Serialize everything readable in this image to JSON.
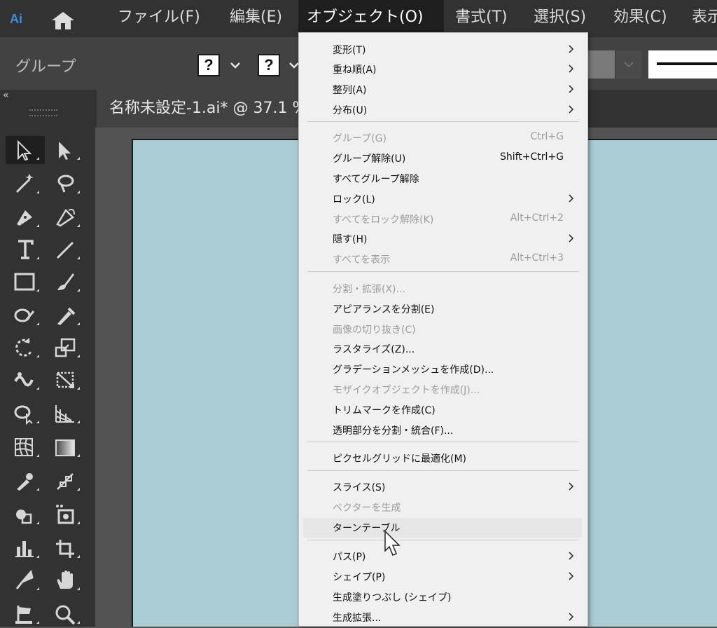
{
  "app": {
    "logo": "Ai"
  },
  "menubar": {
    "items": [
      {
        "label": "ファイル(F)"
      },
      {
        "label": "編集(E)"
      },
      {
        "label": "オブジェクト(O)"
      },
      {
        "label": "書式(T)"
      },
      {
        "label": "選択(S)"
      },
      {
        "label": "効果(C)"
      },
      {
        "label": "表示"
      }
    ],
    "active_index": 2
  },
  "control_bar": {
    "selection_label": "グループ",
    "unknown_fill": "?",
    "unknown_stroke": "?"
  },
  "document": {
    "tab_title": "名称未設定-1.ai* @ 37.1 %"
  },
  "object_menu": {
    "items": [
      {
        "label": "変形(T)",
        "shortcut": "",
        "submenu": true,
        "enabled": true
      },
      {
        "label": "重ね順(A)",
        "shortcut": "",
        "submenu": true,
        "enabled": true
      },
      {
        "label": "整列(A)",
        "shortcut": "",
        "submenu": true,
        "enabled": true
      },
      {
        "label": "分布(U)",
        "shortcut": "",
        "submenu": true,
        "enabled": true
      },
      {
        "label": "グループ(G)",
        "shortcut": "Ctrl+G",
        "submenu": false,
        "enabled": false
      },
      {
        "label": "グループ解除(U)",
        "shortcut": "Shift+Ctrl+G",
        "submenu": false,
        "enabled": true
      },
      {
        "label": "すべてグループ解除",
        "shortcut": "",
        "submenu": false,
        "enabled": true
      },
      {
        "label": "ロック(L)",
        "shortcut": "",
        "submenu": true,
        "enabled": true
      },
      {
        "label": "すべてをロック解除(K)",
        "shortcut": "Alt+Ctrl+2",
        "submenu": false,
        "enabled": false
      },
      {
        "label": "隠す(H)",
        "shortcut": "",
        "submenu": true,
        "enabled": true
      },
      {
        "label": "すべてを表示",
        "shortcut": "Alt+Ctrl+3",
        "submenu": false,
        "enabled": false
      },
      {
        "label": "分割・拡張(X)...",
        "shortcut": "",
        "submenu": false,
        "enabled": false
      },
      {
        "label": "アピアランスを分割(E)",
        "shortcut": "",
        "submenu": false,
        "enabled": true
      },
      {
        "label": "画像の切り抜き(C)",
        "shortcut": "",
        "submenu": false,
        "enabled": false
      },
      {
        "label": "ラスタライズ(Z)...",
        "shortcut": "",
        "submenu": false,
        "enabled": true
      },
      {
        "label": "グラデーションメッシュを作成(D)...",
        "shortcut": "",
        "submenu": false,
        "enabled": true
      },
      {
        "label": "モザイクオブジェクトを作成(J)...",
        "shortcut": "",
        "submenu": false,
        "enabled": false
      },
      {
        "label": "トリムマークを作成(C)",
        "shortcut": "",
        "submenu": false,
        "enabled": true
      },
      {
        "label": "透明部分を分割・統合(F)...",
        "shortcut": "",
        "submenu": false,
        "enabled": true
      },
      {
        "label": "ピクセルグリッドに最適化(M)",
        "shortcut": "",
        "submenu": false,
        "enabled": true
      },
      {
        "label": "スライス(S)",
        "shortcut": "",
        "submenu": true,
        "enabled": true
      },
      {
        "label": "ベクターを生成",
        "shortcut": "",
        "submenu": false,
        "enabled": false
      },
      {
        "label": "ターンテーブル",
        "shortcut": "",
        "submenu": false,
        "enabled": true,
        "hovered": true
      },
      {
        "label": "パス(P)",
        "shortcut": "",
        "submenu": true,
        "enabled": true
      },
      {
        "label": "シェイプ(P)",
        "shortcut": "",
        "submenu": true,
        "enabled": true
      },
      {
        "label": "生成塗りつぶし (シェイプ)",
        "shortcut": "",
        "submenu": false,
        "enabled": true
      },
      {
        "label": "生成拡張...",
        "shortcut": "",
        "submenu": true,
        "enabled": true
      }
    ]
  },
  "tools": [
    "selection-tool-icon",
    "direct-selection-tool-icon",
    "magic-wand-tool-icon",
    "lasso-tool-icon",
    "pen-tool-icon",
    "curvature-tool-icon",
    "type-tool-icon",
    "line-segment-tool-icon",
    "rectangle-tool-icon",
    "paintbrush-tool-icon",
    "shaper-tool-icon",
    "eyedropper-pencil-tool-icon",
    "rotate-tool-icon",
    "scale-tool-icon",
    "warp-tool-icon",
    "free-transform-tool-icon",
    "shape-builder-tool-icon",
    "perspective-grid-tool-icon",
    "mesh-tool-icon",
    "gradient-tool-icon",
    "eyedropper-tool-icon",
    "blend-tool-icon",
    "symbol-sprayer-tool-icon",
    "slice-tool-icon",
    "graph-tool-icon",
    "artboard-tool-icon",
    "knife-tool-icon",
    "hand-tool-icon",
    "flag-tool-icon",
    "zoom-tool-icon"
  ]
}
